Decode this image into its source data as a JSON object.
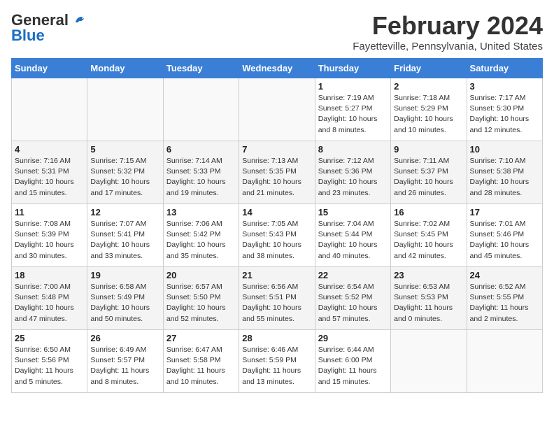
{
  "header": {
    "logo_general": "General",
    "logo_blue": "Blue",
    "main_title": "February 2024",
    "subtitle": "Fayetteville, Pennsylvania, United States"
  },
  "days_of_week": [
    "Sunday",
    "Monday",
    "Tuesday",
    "Wednesday",
    "Thursday",
    "Friday",
    "Saturday"
  ],
  "weeks": [
    [
      {
        "date": "",
        "empty": true
      },
      {
        "date": "",
        "empty": true
      },
      {
        "date": "",
        "empty": true
      },
      {
        "date": "",
        "empty": true
      },
      {
        "date": "1",
        "sunrise": "7:19 AM",
        "sunset": "5:27 PM",
        "daylight": "10 hours and 8 minutes."
      },
      {
        "date": "2",
        "sunrise": "7:18 AM",
        "sunset": "5:29 PM",
        "daylight": "10 hours and 10 minutes."
      },
      {
        "date": "3",
        "sunrise": "7:17 AM",
        "sunset": "5:30 PM",
        "daylight": "10 hours and 12 minutes."
      }
    ],
    [
      {
        "date": "4",
        "sunrise": "7:16 AM",
        "sunset": "5:31 PM",
        "daylight": "10 hours and 15 minutes."
      },
      {
        "date": "5",
        "sunrise": "7:15 AM",
        "sunset": "5:32 PM",
        "daylight": "10 hours and 17 minutes."
      },
      {
        "date": "6",
        "sunrise": "7:14 AM",
        "sunset": "5:33 PM",
        "daylight": "10 hours and 19 minutes."
      },
      {
        "date": "7",
        "sunrise": "7:13 AM",
        "sunset": "5:35 PM",
        "daylight": "10 hours and 21 minutes."
      },
      {
        "date": "8",
        "sunrise": "7:12 AM",
        "sunset": "5:36 PM",
        "daylight": "10 hours and 23 minutes."
      },
      {
        "date": "9",
        "sunrise": "7:11 AM",
        "sunset": "5:37 PM",
        "daylight": "10 hours and 26 minutes."
      },
      {
        "date": "10",
        "sunrise": "7:10 AM",
        "sunset": "5:38 PM",
        "daylight": "10 hours and 28 minutes."
      }
    ],
    [
      {
        "date": "11",
        "sunrise": "7:08 AM",
        "sunset": "5:39 PM",
        "daylight": "10 hours and 30 minutes."
      },
      {
        "date": "12",
        "sunrise": "7:07 AM",
        "sunset": "5:41 PM",
        "daylight": "10 hours and 33 minutes."
      },
      {
        "date": "13",
        "sunrise": "7:06 AM",
        "sunset": "5:42 PM",
        "daylight": "10 hours and 35 minutes."
      },
      {
        "date": "14",
        "sunrise": "7:05 AM",
        "sunset": "5:43 PM",
        "daylight": "10 hours and 38 minutes."
      },
      {
        "date": "15",
        "sunrise": "7:04 AM",
        "sunset": "5:44 PM",
        "daylight": "10 hours and 40 minutes."
      },
      {
        "date": "16",
        "sunrise": "7:02 AM",
        "sunset": "5:45 PM",
        "daylight": "10 hours and 42 minutes."
      },
      {
        "date": "17",
        "sunrise": "7:01 AM",
        "sunset": "5:46 PM",
        "daylight": "10 hours and 45 minutes."
      }
    ],
    [
      {
        "date": "18",
        "sunrise": "7:00 AM",
        "sunset": "5:48 PM",
        "daylight": "10 hours and 47 minutes."
      },
      {
        "date": "19",
        "sunrise": "6:58 AM",
        "sunset": "5:49 PM",
        "daylight": "10 hours and 50 minutes."
      },
      {
        "date": "20",
        "sunrise": "6:57 AM",
        "sunset": "5:50 PM",
        "daylight": "10 hours and 52 minutes."
      },
      {
        "date": "21",
        "sunrise": "6:56 AM",
        "sunset": "5:51 PM",
        "daylight": "10 hours and 55 minutes."
      },
      {
        "date": "22",
        "sunrise": "6:54 AM",
        "sunset": "5:52 PM",
        "daylight": "10 hours and 57 minutes."
      },
      {
        "date": "23",
        "sunrise": "6:53 AM",
        "sunset": "5:53 PM",
        "daylight": "11 hours and 0 minutes."
      },
      {
        "date": "24",
        "sunrise": "6:52 AM",
        "sunset": "5:55 PM",
        "daylight": "11 hours and 2 minutes."
      }
    ],
    [
      {
        "date": "25",
        "sunrise": "6:50 AM",
        "sunset": "5:56 PM",
        "daylight": "11 hours and 5 minutes."
      },
      {
        "date": "26",
        "sunrise": "6:49 AM",
        "sunset": "5:57 PM",
        "daylight": "11 hours and 8 minutes."
      },
      {
        "date": "27",
        "sunrise": "6:47 AM",
        "sunset": "5:58 PM",
        "daylight": "11 hours and 10 minutes."
      },
      {
        "date": "28",
        "sunrise": "6:46 AM",
        "sunset": "5:59 PM",
        "daylight": "11 hours and 13 minutes."
      },
      {
        "date": "29",
        "sunrise": "6:44 AM",
        "sunset": "6:00 PM",
        "daylight": "11 hours and 15 minutes."
      },
      {
        "date": "",
        "empty": true
      },
      {
        "date": "",
        "empty": true
      }
    ]
  ],
  "labels": {
    "sunrise": "Sunrise:",
    "sunset": "Sunset:",
    "daylight": "Daylight:"
  }
}
